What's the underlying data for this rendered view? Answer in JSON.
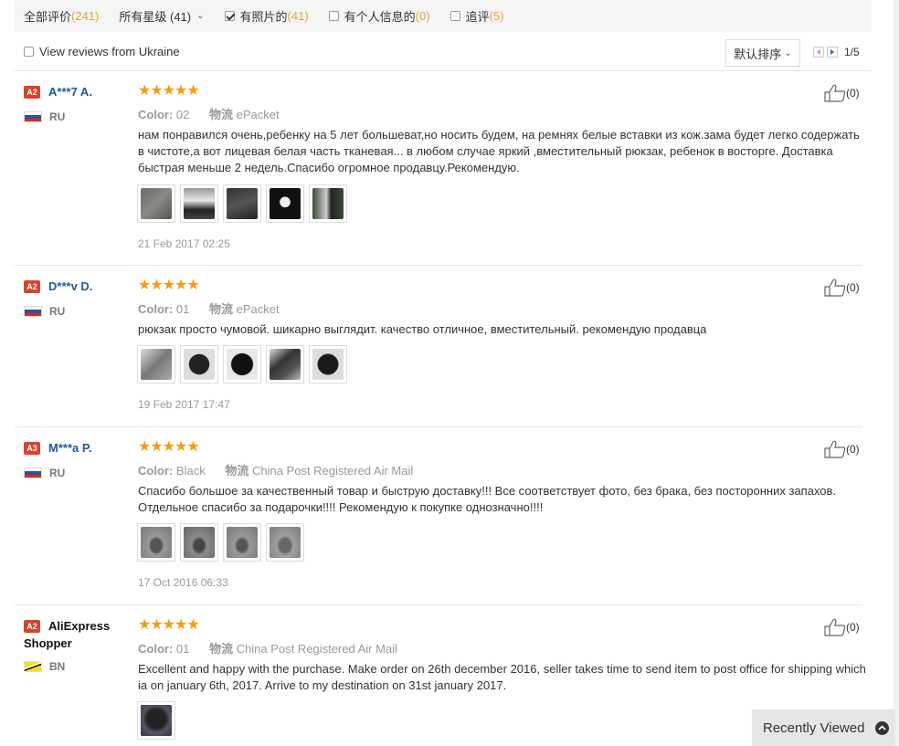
{
  "filters": {
    "all_label": "全部评价",
    "all_count": "(241)",
    "stars_label": "所有星级 (41)",
    "photos_label": "有照片的",
    "photos_count": "(41)",
    "personal_label": "有个人信息的",
    "personal_count": "(0)",
    "followup_label": "追评",
    "followup_count": "(5)"
  },
  "subbar": {
    "ukraine_label": "View reviews from Ukraine",
    "sort_label": "默认排序",
    "page": "1/5"
  },
  "reviews": [
    {
      "badge": "A2",
      "name": "A***7 A.",
      "country": "RU",
      "stars": "★★★★★",
      "color_label": "Color:",
      "color": "02",
      "ship_label": "物流",
      "ship": "ePacket",
      "text": "нам понравился очень,ребенку на 5 лет большеват,но носить будем, на ремнях белые вставки из кож.зама будет легко содержать в чистоте,а вот лицевая белая часть тканевая... в любом случае яркий ,вместительный рюкзак, ребенок в восторге. Доставка быстрая меньше 2 недель.Спасибо огромное продавцу.Рекомендую.",
      "date": "21 Feb 2017 02:25",
      "likes": "(0)"
    },
    {
      "badge": "A2",
      "name": "D***v D.",
      "country": "RU",
      "stars": "★★★★★",
      "color_label": "Color:",
      "color": "01",
      "ship_label": "物流",
      "ship": "ePacket",
      "text": "рюкзак просто чумовой. шикарно выглядит. качество отличное, вместительный. рекомендую продавца",
      "date": "19 Feb 2017 17:47",
      "likes": "(0)"
    },
    {
      "badge": "A3",
      "name": "M***a P.",
      "country": "RU",
      "stars": "★★★★★",
      "color_label": "Color:",
      "color": "Black",
      "ship_label": "物流",
      "ship": "China Post Registered Air Mail",
      "text": "Спасибо большое за качественный товар и быструю доставку!!! Все соответствует фото, без брака, без посторонних запахов. Отдельное спасибо за подарочки!!!! Рекомендую к покупке однозначно!!!!",
      "date": "17 Oct 2016 06:33",
      "likes": "(0)"
    },
    {
      "badge": "A2",
      "name": "AliExpress Shopper",
      "country": "BN",
      "stars": "★★★★★",
      "color_label": "Color:",
      "color": "01",
      "ship_label": "物流",
      "ship": "China Post Registered Air Mail",
      "text": "Excellent and happy with the purchase. Make order on 26th december 2016, seller takes time to send item to post office for shipping which ia on january 6th, 2017. Arrive to my destination on 31st january 2017.",
      "date": "",
      "likes": "(0)"
    }
  ],
  "recently_viewed": "Recently Viewed",
  "colors": {
    "accent_count": "#e8a23a",
    "star": "#f39c12",
    "name_link": "#1e5a9c",
    "badge": "#d9432b"
  },
  "icons": [
    "checkbox-icon",
    "chevron-down-icon",
    "thumbs-up-icon",
    "flag-icon",
    "chevron-up-icon"
  ]
}
